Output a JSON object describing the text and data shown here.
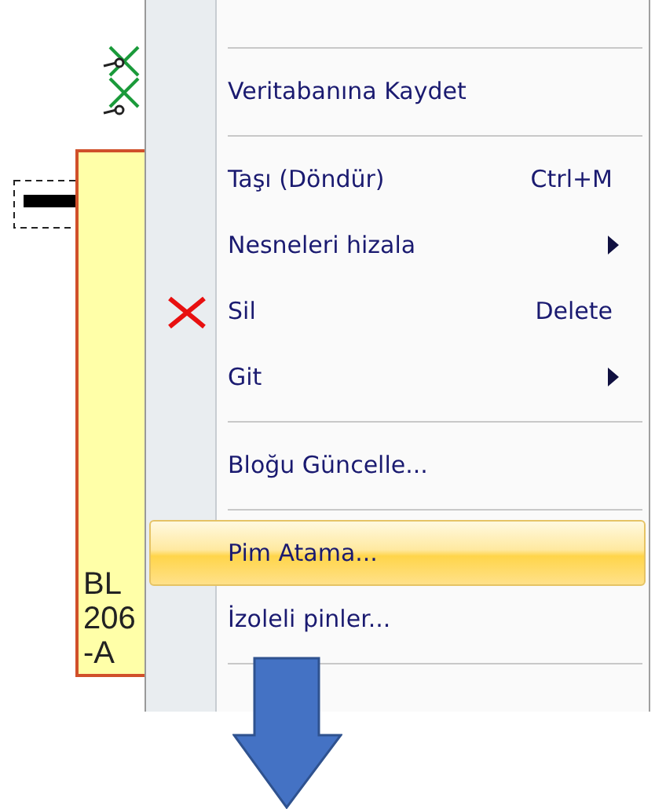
{
  "block": {
    "lines": [
      "BL",
      "206",
      "-A"
    ]
  },
  "menu": {
    "items": [
      {
        "kind": "separator"
      },
      {
        "kind": "item",
        "label": "Veritabanına Kaydet",
        "submenu": false,
        "selected": false
      },
      {
        "kind": "separator"
      },
      {
        "kind": "item",
        "label": "Taşı (Döndür)",
        "shortcut": "Ctrl+M",
        "submenu": false,
        "selected": false
      },
      {
        "kind": "item",
        "label": "Nesneleri hizala",
        "submenu": true,
        "selected": false
      },
      {
        "kind": "icon-item",
        "label": "Sil",
        "shortcut": "Delete",
        "submenu": false,
        "selected": false
      },
      {
        "kind": "item",
        "label": "Git",
        "submenu": true,
        "selected": false
      },
      {
        "kind": "separator"
      },
      {
        "kind": "item",
        "label": "Bloğu Güncelle...",
        "submenu": false,
        "selected": false
      },
      {
        "kind": "separator"
      },
      {
        "kind": "item",
        "label": "Pim Atama...",
        "submenu": false,
        "selected": true
      },
      {
        "kind": "item",
        "label": "İzoleli pinler...",
        "submenu": false,
        "selected": false
      },
      {
        "kind": "separator"
      }
    ]
  }
}
